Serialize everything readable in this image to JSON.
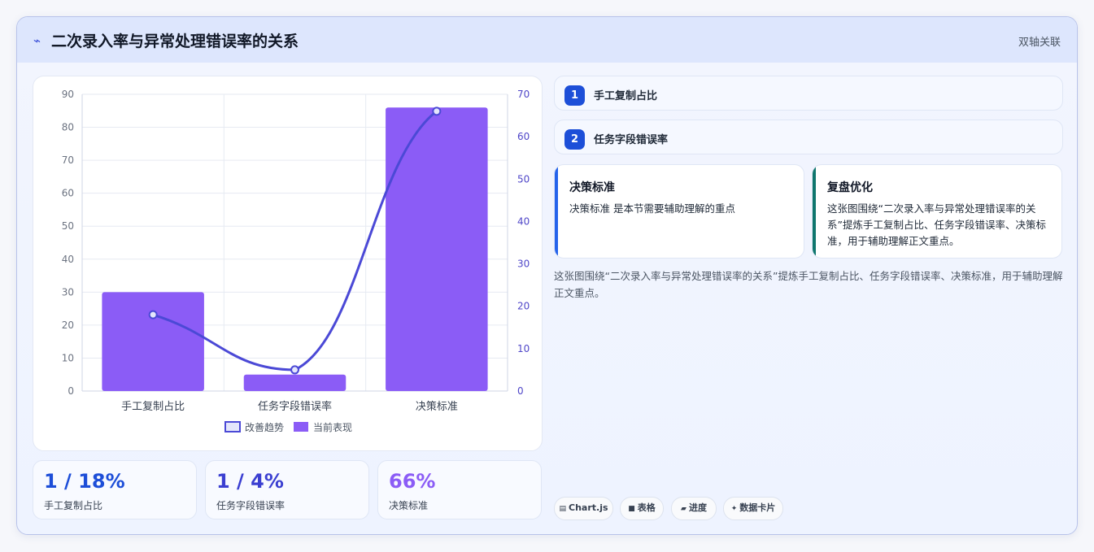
{
  "header": {
    "icon": "bolt-icon",
    "title": "二次录入率与异常处理错误率的关系",
    "tag": "双轴关联"
  },
  "chart_data": {
    "type": "bar",
    "categories": [
      "手工复制占比",
      "任务字段错误率",
      "决策标准"
    ],
    "series": [
      {
        "name": "改善趋势",
        "kind": "line",
        "axis": "right",
        "values": [
          18,
          5,
          66
        ],
        "color": "#4b49d6"
      },
      {
        "name": "当前表现",
        "kind": "bar",
        "axis": "left",
        "values": [
          30,
          5,
          86
        ],
        "color": "#8b5cf6"
      }
    ],
    "y_left": {
      "min": 0,
      "max": 90,
      "ticks": [
        0,
        10,
        20,
        30,
        40,
        50,
        60,
        70,
        80,
        90
      ]
    },
    "y_right": {
      "min": 0,
      "max": 70,
      "ticks": [
        0,
        10,
        20,
        30,
        40,
        50,
        60,
        70
      ]
    },
    "grid": true,
    "legend_position": "bottom"
  },
  "stats": [
    {
      "value": "1 / 18%",
      "label": "手工复制占比",
      "color": "#1d4ed8"
    },
    {
      "value": "1 / 4%",
      "label": "任务字段错误率",
      "color": "#3b3fd1"
    },
    {
      "value": "66%",
      "label": "决策标准",
      "color": "#8b5cf6"
    }
  ],
  "steps": [
    {
      "num": "1",
      "label": "手工复制占比"
    },
    {
      "num": "2",
      "label": "任务字段错误率"
    }
  ],
  "notes": [
    {
      "title": "决策标准",
      "body": "决策标准 是本节需要辅助理解的重点",
      "accent": "#2563eb"
    },
    {
      "title": "复盘优化",
      "body": "这张图围绕“二次录入率与异常处理错误率的关系”提炼手工复制占比、任务字段错误率、决策标准，用于辅助理解正文重点。",
      "accent": "#0f766e"
    }
  ],
  "summary": "这张图围绕“二次录入率与异常处理错误率的关系”提炼手工复制占比、任务字段错误率、决策标准，用于辅助理解正文重点。",
  "pills": [
    {
      "icon": "chart-icon",
      "glyph": "▤",
      "label": "Chart.js"
    },
    {
      "icon": "table-icon",
      "glyph": "■",
      "label": "表格"
    },
    {
      "icon": "progress-icon",
      "glyph": "▰",
      "label": "进度"
    },
    {
      "icon": "sparkle-icon",
      "glyph": "✦",
      "label": "数据卡片"
    }
  ]
}
